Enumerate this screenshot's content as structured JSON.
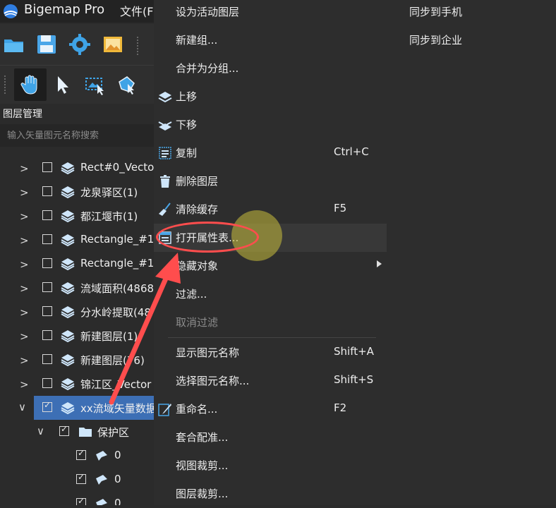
{
  "app": {
    "title": "Bigemap Pro",
    "menu_file": "文件(F"
  },
  "toolbar1": {
    "icons": [
      "open-folder-icon",
      "save-icon",
      "gear-icon",
      "image-icon"
    ]
  },
  "toolbar2": {
    "icons": [
      "hand-icon",
      "cursor-arrow-icon",
      "select-image-icon",
      "select-shape-icon"
    ]
  },
  "panel": {
    "title": "图层管理",
    "search_placeholder": "输入矢量图元名称搜索"
  },
  "tree": {
    "rows": [
      {
        "label": "Rect#0_Vecto",
        "checked": false,
        "expand": ">"
      },
      {
        "label": "龙泉驿区(1)",
        "checked": false,
        "expand": ">"
      },
      {
        "label": "都江堰市(1)",
        "checked": false,
        "expand": ">"
      },
      {
        "label": "Rectangle_#1",
        "checked": false,
        "expand": ">"
      },
      {
        "label": "Rectangle_#1",
        "checked": false,
        "expand": ">"
      },
      {
        "label": "流域面积(4868",
        "checked": false,
        "expand": ">"
      },
      {
        "label": "分水岭提取(48",
        "checked": false,
        "expand": ">"
      },
      {
        "label": "新建图层(1)",
        "checked": false,
        "expand": ">"
      },
      {
        "label": "新建图层(76)",
        "checked": false,
        "expand": ">"
      },
      {
        "label": "锦江区_Vector",
        "checked": false,
        "expand": ">"
      },
      {
        "label": "xx流域矢量数据",
        "checked": true,
        "expand": "∨",
        "selected": true
      },
      {
        "label": "保护区",
        "checked": true,
        "expand": "∨"
      },
      {
        "label": "0",
        "checked": true
      },
      {
        "label": "0",
        "checked": true
      },
      {
        "label": "0",
        "checked": true
      }
    ]
  },
  "context_menu": {
    "items": [
      {
        "label": "设为活动图层",
        "shortcut": "",
        "icon": ""
      },
      {
        "label": "新建组...",
        "shortcut": "",
        "icon": ""
      },
      {
        "label": "合并为分组...",
        "shortcut": "",
        "icon": ""
      },
      {
        "label": "上移",
        "shortcut": "",
        "icon": "layers-up-icon"
      },
      {
        "label": "下移",
        "shortcut": "",
        "icon": "layers-down-icon"
      },
      {
        "label": "复制",
        "shortcut": "Ctrl+C",
        "icon": "copy-icon"
      },
      {
        "label": "删除图层",
        "shortcut": "",
        "icon": "trash-icon"
      },
      {
        "label": "清除缓存",
        "shortcut": "F5",
        "icon": "broom-icon"
      },
      {
        "label": "打开属性表...",
        "shortcut": "",
        "icon": "table-icon"
      },
      {
        "label": "隐藏对象",
        "shortcut": "",
        "icon": ""
      },
      {
        "label": "过滤...",
        "shortcut": "",
        "icon": ""
      },
      {
        "label": "取消过滤",
        "shortcut": "",
        "icon": "",
        "disabled": true
      },
      {
        "label": "显示图元名称",
        "shortcut": "Shift+A",
        "icon": ""
      },
      {
        "label": "选择图元名称...",
        "shortcut": "Shift+S",
        "icon": ""
      },
      {
        "label": "重命名...",
        "shortcut": "F2",
        "icon": "pencil-icon"
      },
      {
        "label": "套合配准...",
        "shortcut": "",
        "icon": ""
      },
      {
        "label": "视图裁剪...",
        "shortcut": "",
        "icon": ""
      },
      {
        "label": "图层裁剪...",
        "shortcut": "",
        "icon": ""
      }
    ],
    "right_column": [
      "同步到手机",
      "同步到企业"
    ]
  },
  "colors": {
    "selection": "#3d6fb5",
    "annotation": "#ff4d4d",
    "highlight": "#c8be3c"
  }
}
